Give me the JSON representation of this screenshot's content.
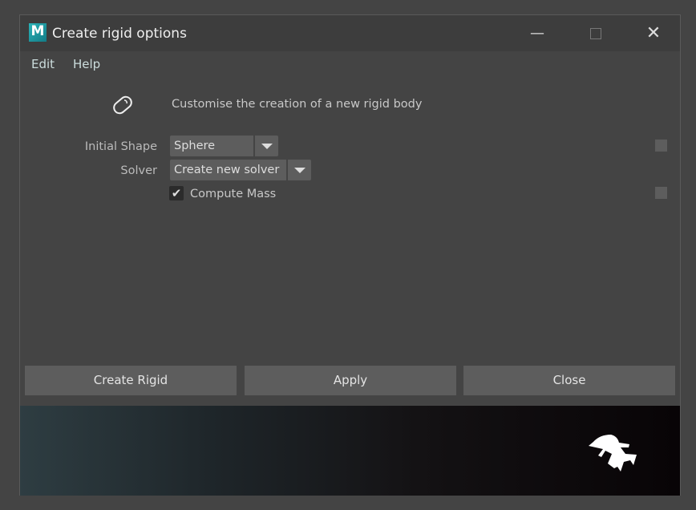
{
  "window": {
    "title": "Create rigid options",
    "logo_letter": "M"
  },
  "menu": [
    "Edit",
    "Help"
  ],
  "description": "Customise the creation of a new rigid body",
  "fields": {
    "initial_shape": {
      "label": "Initial Shape",
      "value": "Sphere"
    },
    "solver": {
      "label": "Solver",
      "value": "Create new solver"
    },
    "compute_mass": {
      "label": "Compute Mass",
      "checked": true
    }
  },
  "buttons": {
    "create": "Create Rigid",
    "apply": "Apply",
    "close": "Close"
  }
}
